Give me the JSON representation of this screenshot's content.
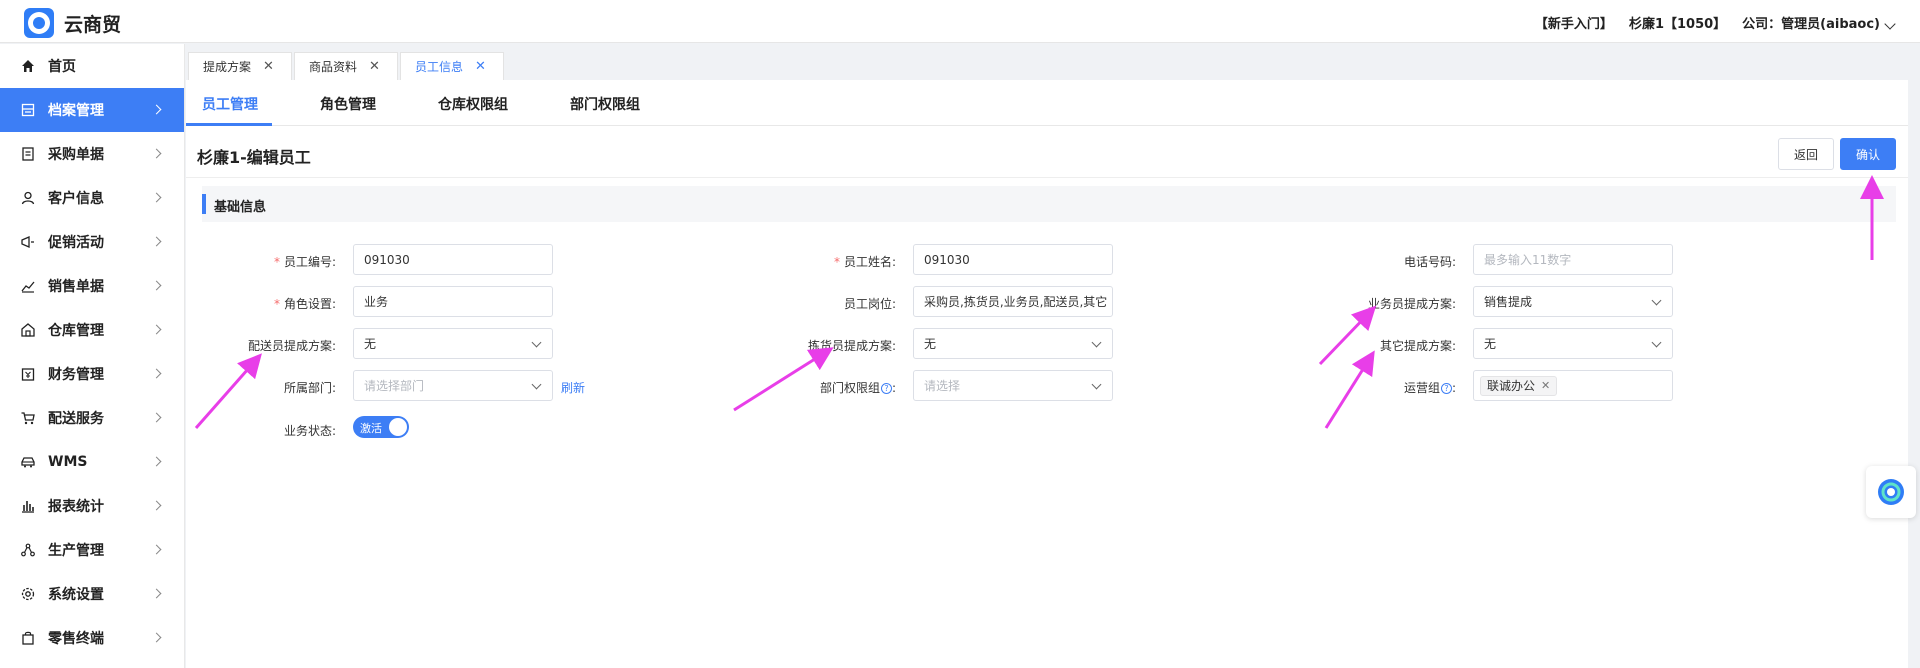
{
  "header": {
    "brand": "云商贸",
    "guide": "【新手入门】",
    "account": "杉廉1【1050】",
    "company": "公司：管理员(aibaoc)"
  },
  "sidebar": {
    "items": [
      {
        "label": "首页",
        "icon": "home-icon"
      },
      {
        "label": "档案管理",
        "icon": "archive-icon",
        "active": true
      },
      {
        "label": "采购单据",
        "icon": "document-icon"
      },
      {
        "label": "客户信息",
        "icon": "user-icon"
      },
      {
        "label": "促销活动",
        "icon": "megaphone-icon"
      },
      {
        "label": "销售单据",
        "icon": "chart-line-icon"
      },
      {
        "label": "仓库管理",
        "icon": "warehouse-icon"
      },
      {
        "label": "财务管理",
        "icon": "finance-icon"
      },
      {
        "label": "配送服务",
        "icon": "cart-icon"
      },
      {
        "label": "WMS",
        "icon": "car-icon"
      },
      {
        "label": "报表统计",
        "icon": "bar-chart-icon"
      },
      {
        "label": "生产管理",
        "icon": "network-icon"
      },
      {
        "label": "系统设置",
        "icon": "gear-icon"
      },
      {
        "label": "零售终端",
        "icon": "bag-icon"
      }
    ]
  },
  "tabs": [
    {
      "label": "提成方案"
    },
    {
      "label": "商品资料"
    },
    {
      "label": "员工信息",
      "active": true
    }
  ],
  "subtabs": [
    {
      "label": "员工管理",
      "active": true
    },
    {
      "label": "角色管理"
    },
    {
      "label": "仓库权限组"
    },
    {
      "label": "部门权限组"
    }
  ],
  "page": {
    "title": "杉廉1-编辑员工",
    "back_label": "返回",
    "confirm_label": "确认",
    "section_title": "基础信息"
  },
  "form": {
    "employee_no_label": "员工编号:",
    "employee_no_value": "091030",
    "employee_name_label": "员工姓名:",
    "employee_name_value": "091030",
    "phone_label": "电话号码:",
    "phone_placeholder": "最多输入11数字",
    "role_label": "角色设置:",
    "role_value": "业务",
    "position_label": "员工岗位:",
    "position_value": "采购员,拣货员,业务员,配送员,其它",
    "sales_commission_label": "业务员提成方案:",
    "sales_commission_value": "销售提成",
    "delivery_commission_label": "配送员提成方案:",
    "delivery_commission_value": "无",
    "picker_commission_label": "拣货员提成方案:",
    "picker_commission_value": "无",
    "other_commission_label": "其它提成方案:",
    "other_commission_value": "无",
    "department_label": "所属部门:",
    "department_placeholder": "请选择部门",
    "refresh_label": "刷新",
    "dept_perm_label": "部门权限组",
    "dept_perm_suffix": ":",
    "dept_perm_placeholder": "请选择",
    "ops_group_label": "运营组",
    "ops_group_suffix": ":",
    "ops_group_tag": "联诚办公",
    "status_label": "业务状态:",
    "status_value": "激活"
  },
  "colors": {
    "accent": "#3d7ef5",
    "annotation": "#e83ee8",
    "required": "#f56c6c"
  }
}
